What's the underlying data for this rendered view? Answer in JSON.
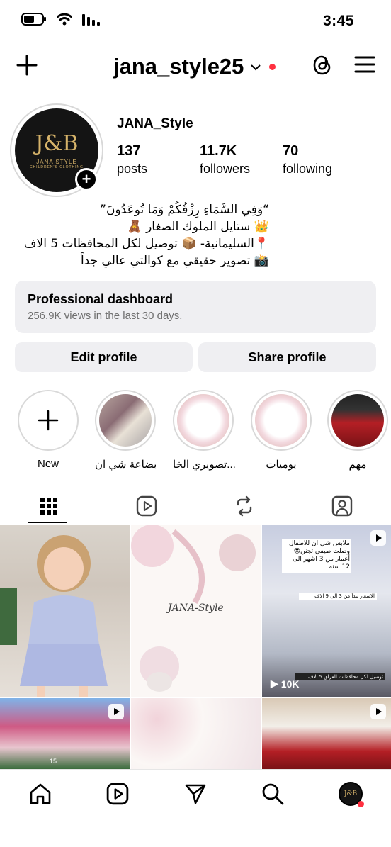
{
  "status_bar": {
    "time": "3:45",
    "icons": [
      "battery-icon",
      "wifi-icon",
      "signal-icon"
    ]
  },
  "top_bar": {
    "username": "jana_style25",
    "icons": [
      "plus-icon",
      "chevron-down-icon",
      "threads-icon",
      "menu-icon"
    ],
    "notification_dot_color": "#ff3040"
  },
  "profile": {
    "avatar": {
      "monogram": "J&B",
      "brand": "JANA STYLE",
      "tagline": "CHILDREN'S CLOTHING"
    },
    "display_name": "JANA_Style",
    "stats": [
      {
        "value": "137",
        "label": "posts"
      },
      {
        "value": "11.7K",
        "label": "followers"
      },
      {
        "value": "70",
        "label": "following"
      }
    ],
    "bio_lines": [
      "“وَفِي السَّمَاءِ رِزْقُكُمْ وَمَا تُوعَدُونَ”",
      "👑 ستايل الملوك الصغار 🧸",
      "📍السليمانية- 📦 توصيل لكل المحافظات 5 الاف",
      "📸 تصوير حقيقي مع كوالتي عالي جداً"
    ]
  },
  "dashboard": {
    "title": "Professional dashboard",
    "subtitle": "256.9K views in the last 30 days."
  },
  "buttons": {
    "edit": "Edit profile",
    "share": "Share profile"
  },
  "highlights": [
    {
      "label": "New"
    },
    {
      "label": "بضاعة شي ان"
    },
    {
      "label": "تصويري الخا..."
    },
    {
      "label": "يوميات"
    },
    {
      "label": "مهم"
    }
  ],
  "tabs": [
    "grid-icon",
    "reels-icon",
    "reposts-icon",
    "tagged-icon"
  ],
  "posts": [
    {
      "type": "photo"
    },
    {
      "type": "photo",
      "text": "JANA-Style"
    },
    {
      "type": "reel",
      "views": "10K",
      "caption_top": "ملابس شي ان للاطفال وصلت صيفي تجنن😍 أعمار من 3 اشهر الى 12 سنه",
      "caption_mid": "الاسعار تبدأ من 3 الى 9 الاف",
      "caption_bottom": "توصيل لكل محافظات العراق 5 الاف"
    },
    {
      "type": "reel",
      "caption": "15 ...."
    },
    {
      "type": "photo"
    },
    {
      "type": "reel"
    }
  ],
  "bottom_nav": [
    "home-icon",
    "reels-icon",
    "send-icon",
    "search-icon",
    "profile-avatar"
  ],
  "colors": {
    "accent_red": "#ff3040",
    "button_gray": "#efeff2"
  }
}
